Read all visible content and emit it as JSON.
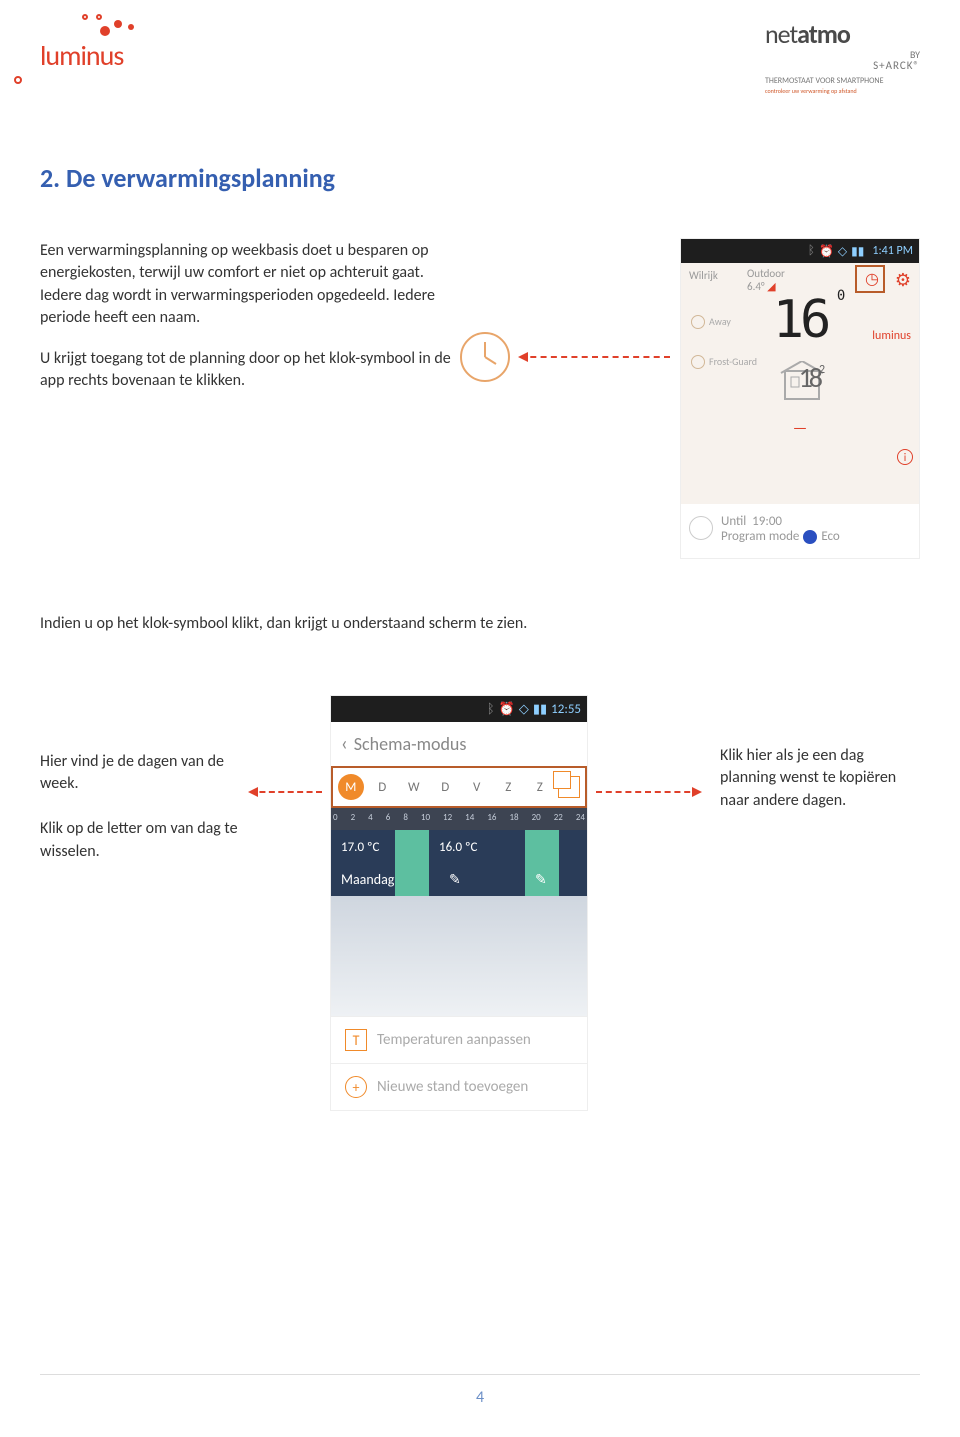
{
  "header": {
    "brand1": "luminus",
    "brand2_light": "net",
    "brand2_bold": "atmo",
    "brand2_by": "BY",
    "brand2_starck": "S+ARCK®",
    "brand2_sub1": "THERMOSTAAT VOOR SMARTPHONE",
    "brand2_sub2": "controleer uw verwarming op afstand"
  },
  "section_title": "2.  De verwarmingsplanning",
  "para1": "Een verwarmingsplanning op weekbasis doet u besparen op energiekosten, terwijl uw comfort er niet op achteruit gaat. Iedere dag wordt in verwarmingsperioden opgedeeld. Iedere periode heeft een naam.",
  "para2": "U krijgt toegang tot de planning door op het klok-symbool in de app rechts bovenaan te klikken.",
  "midtext": "Indien u op het klok-symbool klikt, dan krijgt u onderstaand scherm te zien.",
  "left_side": "Hier vind je de dagen van de week.\n\nKlik op de letter om van dag te wisselen.",
  "right_side": "Klik hier als je een dag planning wenst te kopiëren naar andere dagen.",
  "phone1": {
    "status_time": "1:41 PM",
    "location": "Wilrijk",
    "outdoor_label": "Outdoor",
    "outdoor_temp": "6.4°",
    "big_temp": "16",
    "big_temp_sup": "0",
    "mode_away": "Away",
    "mode_frost": "Frost-Guard",
    "mini_brand": "luminus",
    "house_temp": "18",
    "house_sup": "2",
    "until_label": "Until",
    "until_time": "19:00",
    "program_mode_label": "Program mode",
    "program_mode_value": "Eco"
  },
  "phone2": {
    "status_time": "12:55",
    "back": "‹",
    "header": "Schema-modus",
    "days": [
      "M",
      "D",
      "W",
      "D",
      "V",
      "Z",
      "Z"
    ],
    "active_day_index": 0,
    "time_ticks": [
      "0",
      "2",
      "4",
      "6",
      "8",
      "10",
      "12",
      "14",
      "16",
      "18",
      "20",
      "22",
      "24"
    ],
    "temp1": "17.0 ºC",
    "temp2": "16.0 ºC",
    "day_label": "Maandag",
    "opt1": "Temperaturen aanpassen",
    "opt2": "Nieuwe stand toevoegen"
  },
  "page_number": "4"
}
